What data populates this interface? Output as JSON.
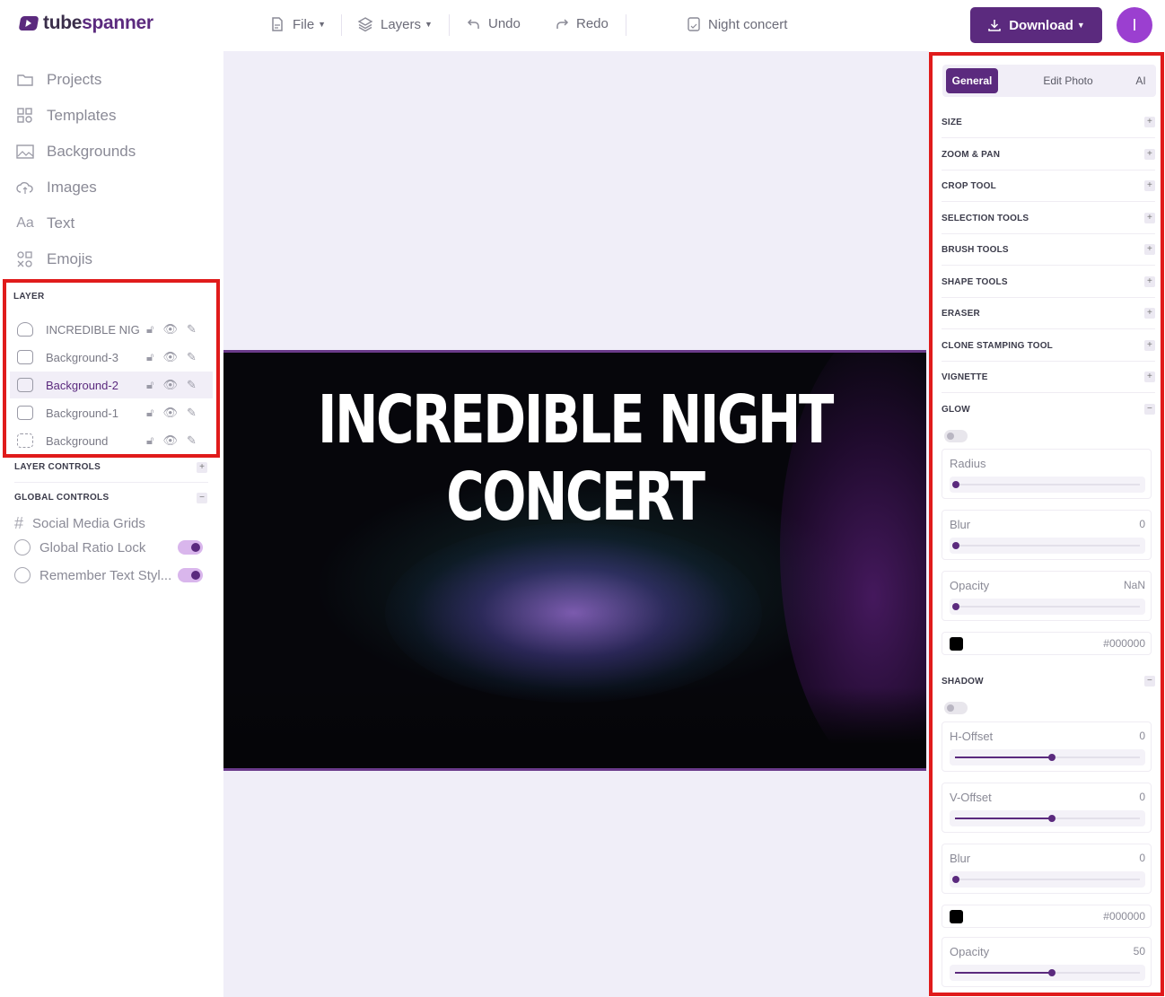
{
  "app": {
    "brand_prefix": "tube",
    "brand_suffix": "spanner"
  },
  "toolbar": {
    "file": "File",
    "layers": "Layers",
    "undo": "Undo",
    "redo": "Redo",
    "project_name": "Night concert",
    "download": "Download",
    "avatar_initial": "I"
  },
  "sidebar": {
    "nav": [
      {
        "label": "Projects",
        "icon": "folder-icon"
      },
      {
        "label": "Templates",
        "icon": "templates-icon"
      },
      {
        "label": "Backgrounds",
        "icon": "backgrounds-icon"
      },
      {
        "label": "Images",
        "icon": "cloud-icon"
      },
      {
        "label": "Text",
        "icon": "text-icon"
      },
      {
        "label": "Emojis",
        "icon": "emoji-icon"
      }
    ],
    "layer_title": "LAYER",
    "layers": [
      {
        "name": "INCREDIBLE NIG...",
        "active": false
      },
      {
        "name": "Background-3",
        "active": false
      },
      {
        "name": "Background-2",
        "active": true
      },
      {
        "name": "Background-1",
        "active": false
      },
      {
        "name": "Background",
        "active": false
      }
    ],
    "layer_controls": "LAYER CONTROLS",
    "global_controls": "GLOBAL CONTROLS",
    "global_items": [
      {
        "label": "Social Media Grids",
        "toggle": false
      },
      {
        "label": "Global Ratio Lock",
        "toggle": true
      },
      {
        "label": "Remember Text Styl...",
        "toggle": true
      }
    ]
  },
  "canvas": {
    "title_line1": "INCREDIBLE NIGHT",
    "title_line2": "CONCERT"
  },
  "panel": {
    "tabs": [
      "General",
      "Edit Photo",
      "AI"
    ],
    "active_tab": "General",
    "sections": [
      "SIZE",
      "ZOOM & PAN",
      "CROP TOOL",
      "SELECTION TOOLS",
      "BRUSH TOOLS",
      "SHAPE TOOLS",
      "ERASER",
      "CLONE STAMPING TOOL",
      "VIGNETTE"
    ],
    "glow": {
      "title": "GLOW",
      "radius_label": "Radius",
      "blur_label": "Blur",
      "blur_value": "0",
      "opacity_label": "Opacity",
      "opacity_value": "NaN",
      "color": "#000000"
    },
    "shadow": {
      "title": "SHADOW",
      "hoffset_label": "H-Offset",
      "hoffset_value": "0",
      "voffset_label": "V-Offset",
      "voffset_value": "0",
      "blur_label": "Blur",
      "blur_value": "0",
      "color": "#000000",
      "opacity_label": "Opacity",
      "opacity_value": "50"
    }
  },
  "colors": {
    "accent": "#5b2a7e",
    "highlight_border": "#e01b1b",
    "workspace": "#f0eef8"
  }
}
